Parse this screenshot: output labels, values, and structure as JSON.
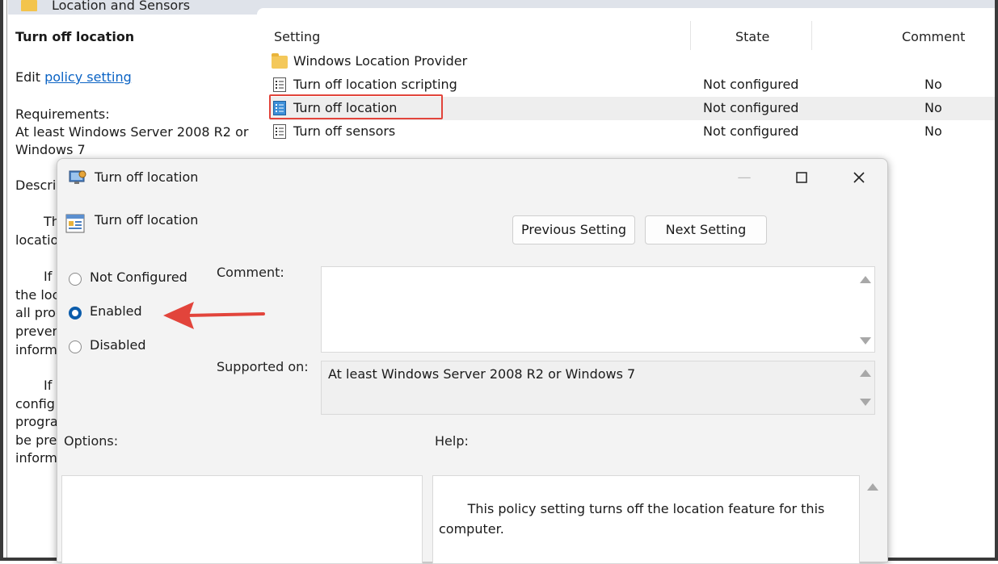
{
  "header": {
    "folder_title": "Location and Sensors"
  },
  "left_pane": {
    "title": "Turn off location",
    "edit_prefix": "Edit",
    "edit_link": "policy setting",
    "requirements_label": "Requirements:",
    "requirements_line1": "At least Windows Server 2008 R2 or",
    "requirements_line2": "Windows 7",
    "fragments": [
      "Descrip",
      "Th",
      "locatio",
      "If",
      "the loc",
      "all prog",
      "preven",
      "inform",
      "If",
      "config",
      "progra",
      "be pre",
      "inform"
    ]
  },
  "list": {
    "columns": {
      "setting": "Setting",
      "state": "State",
      "comment": "Comment"
    },
    "rows": [
      {
        "name": "Windows Location Provider",
        "state": "",
        "comment": "",
        "icon": "folder-icon"
      },
      {
        "name": "Turn off location scripting",
        "state": "Not configured",
        "comment": "No",
        "icon": "policy-icon"
      },
      {
        "name": "Turn off location",
        "state": "Not configured",
        "comment": "No",
        "icon": "policy-icon"
      },
      {
        "name": "Turn off sensors",
        "state": "Not configured",
        "comment": "No",
        "icon": "policy-icon"
      }
    ],
    "highlight_color": "#e2443b"
  },
  "dialog": {
    "title": "Turn off location",
    "setting_name": "Turn off location",
    "prev_button": "Previous Setting",
    "next_button": "Next Setting",
    "radios": {
      "not_configured": "Not Configured",
      "enabled": "Enabled",
      "disabled": "Disabled",
      "selected": "Enabled"
    },
    "comment_label": "Comment:",
    "comment_value": "",
    "supported_label": "Supported on:",
    "supported_value": "At least Windows Server 2008 R2 or Windows 7",
    "options_label": "Options:",
    "help_label": "Help:",
    "help_text": "This policy setting turns off the location feature for this computer.",
    "annotation_arrow_color": "#e2443b",
    "accent_color": "#0b5cab"
  }
}
